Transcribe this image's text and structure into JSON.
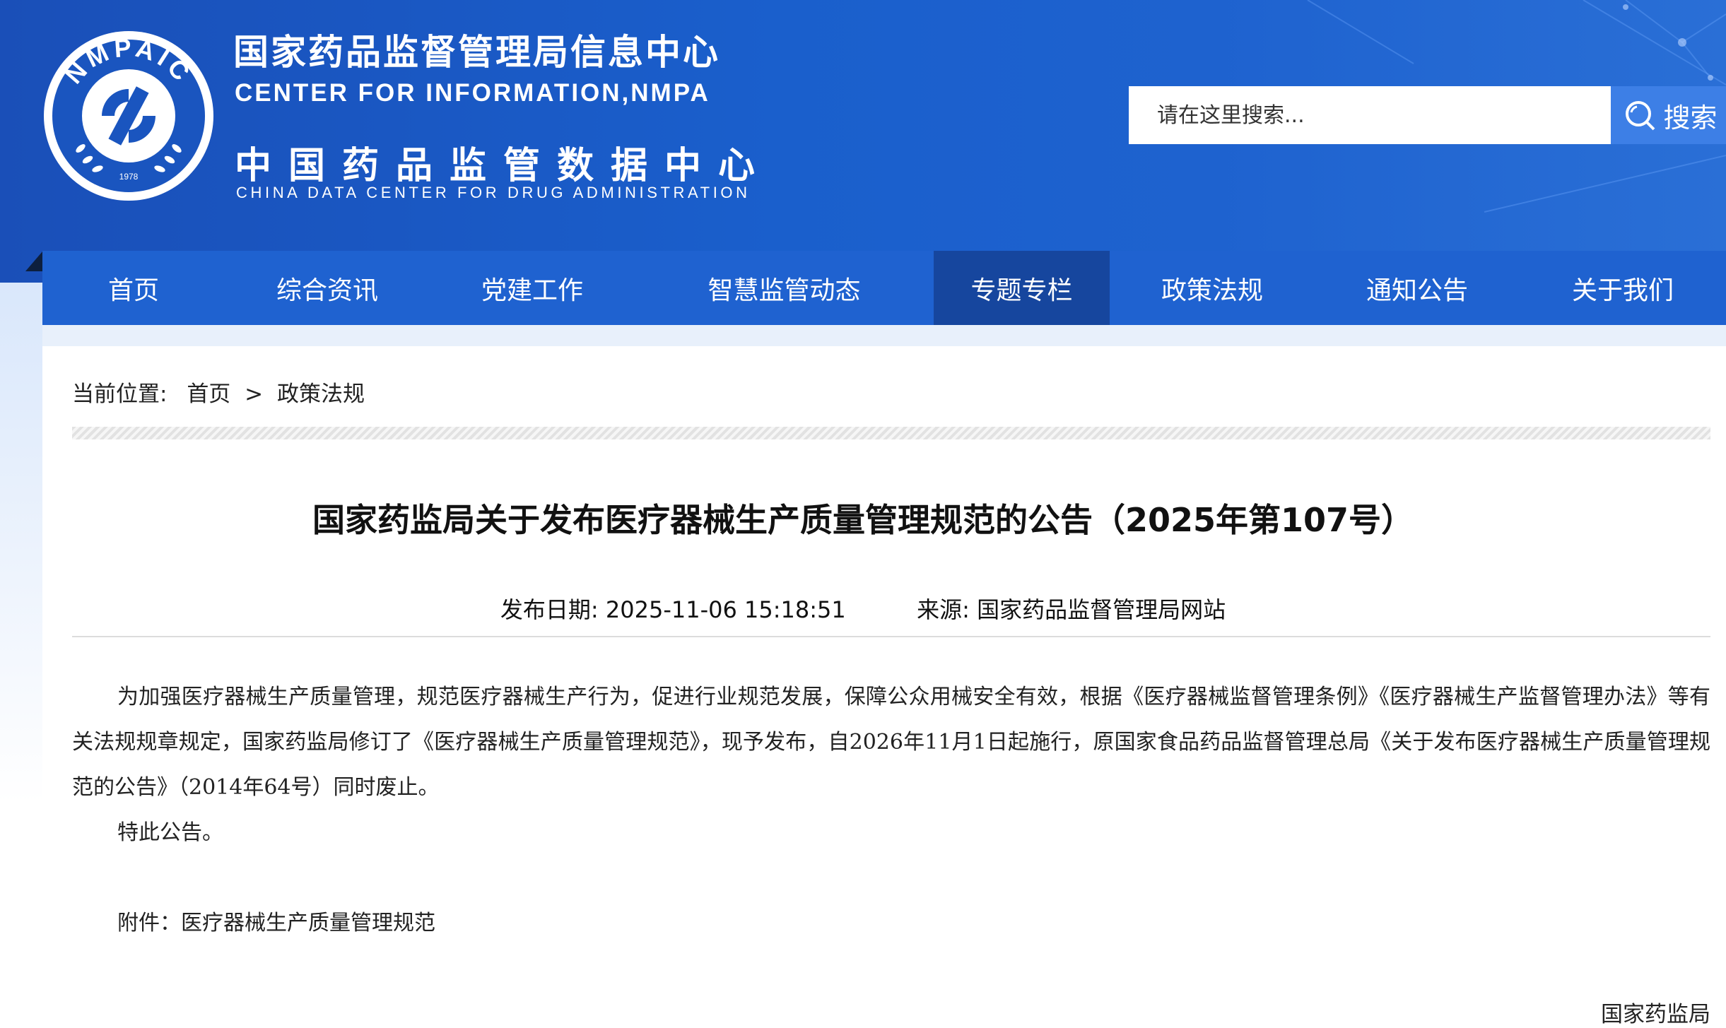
{
  "header": {
    "logo_text": "NMPAIC",
    "logo_year": "1978",
    "brand_cn_primary": "国家药品监督管理局信息中心",
    "brand_en_primary": "CENTER FOR INFORMATION,NMPA",
    "brand_cn_secondary": "中国药品监管数据中心",
    "brand_en_secondary": "CHINA DATA CENTER FOR DRUG ADMINISTRATION",
    "search": {
      "placeholder": "请在这里搜索...",
      "button_label": "搜索",
      "button_icon": "search-icon",
      "button_color": "#3d7fe6"
    }
  },
  "nav": {
    "color": "#1f62d0",
    "active_color": "#16469e",
    "items": [
      {
        "label": "首页"
      },
      {
        "label": "综合资讯"
      },
      {
        "label": "党建工作"
      },
      {
        "label": "智慧监管动态"
      },
      {
        "label": "专题专栏",
        "active": true
      },
      {
        "label": "政策法规"
      },
      {
        "label": "通知公告"
      },
      {
        "label": "关于我们"
      }
    ]
  },
  "breadcrumb": {
    "prefix": "当前位置:",
    "home": "首页",
    "separator": ">",
    "current": "政策法规"
  },
  "article": {
    "title": "国家药监局关于发布医疗器械生产质量管理规范的公告（2025年第107号）",
    "date_label": "发布日期:",
    "date_value": "2025-11-06 15:18:51",
    "source_label": "来源:",
    "source_value": "国家药品监督管理局网站",
    "paragraphs": [
      "为加强医疗器械生产质量管理，规范医疗器械生产行为，促进行业规范发展，保障公众用械安全有效，根据《医疗器械监督管理条例》《医疗器械生产监督管理办法》等有关法规规章规定，国家药监局修订了《医疗器械生产质量管理规范》，现予发布，自2026年11月1日起施行，原国家食品药品监督管理总局《关于发布医疗器械生产质量管理规范的公告》（2014年64号）同时废止。",
      "特此公告。",
      "附件：医疗器械生产质量管理规范"
    ],
    "signature": "国家药监局"
  }
}
